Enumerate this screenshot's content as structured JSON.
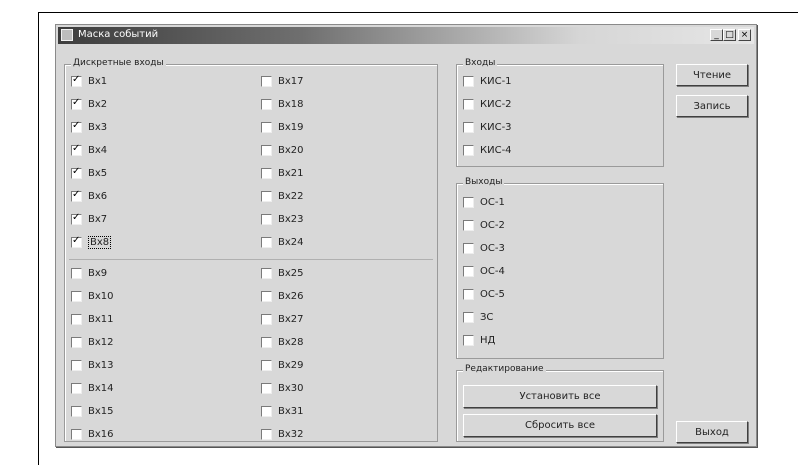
{
  "window": {
    "title": "Маска событий",
    "controls": {
      "minimize": "_",
      "maximize": "□",
      "close": "×"
    }
  },
  "discrete_inputs": {
    "legend": "Дискретные входы",
    "col1": [
      {
        "label": "Вх1",
        "checked": true
      },
      {
        "label": "Вх2",
        "checked": true
      },
      {
        "label": "Вх3",
        "checked": true
      },
      {
        "label": "Вх4",
        "checked": true
      },
      {
        "label": "Вх5",
        "checked": true
      },
      {
        "label": "Вх6",
        "checked": true
      },
      {
        "label": "Вх7",
        "checked": true
      },
      {
        "label": "Вх8",
        "checked": true
      },
      {
        "label": "Вх9",
        "checked": false
      },
      {
        "label": "Вх10",
        "checked": false
      },
      {
        "label": "Вх11",
        "checked": false
      },
      {
        "label": "Вх12",
        "checked": false
      },
      {
        "label": "Вх13",
        "checked": false
      },
      {
        "label": "Вх14",
        "checked": false
      },
      {
        "label": "Вх15",
        "checked": false
      },
      {
        "label": "Вх16",
        "checked": false
      }
    ],
    "col2": [
      {
        "label": "Вх17",
        "checked": false
      },
      {
        "label": "Вх18",
        "checked": false
      },
      {
        "label": "Вх19",
        "checked": false
      },
      {
        "label": "Вх20",
        "checked": false
      },
      {
        "label": "Вх21",
        "checked": false
      },
      {
        "label": "Вх22",
        "checked": false
      },
      {
        "label": "Вх23",
        "checked": false
      },
      {
        "label": "Вх24",
        "checked": false
      },
      {
        "label": "Вх25",
        "checked": false
      },
      {
        "label": "Вх26",
        "checked": false
      },
      {
        "label": "Вх27",
        "checked": false
      },
      {
        "label": "Вх28",
        "checked": false
      },
      {
        "label": "Вх29",
        "checked": false
      },
      {
        "label": "Вх30",
        "checked": false
      },
      {
        "label": "Вх31",
        "checked": false
      },
      {
        "label": "Вх32",
        "checked": false
      }
    ]
  },
  "inputs_group": {
    "legend": "Входы",
    "items": [
      {
        "label": "КИС-1",
        "checked": false
      },
      {
        "label": "КИС-2",
        "checked": false
      },
      {
        "label": "КИС-3",
        "checked": false
      },
      {
        "label": "КИС-4",
        "checked": false
      }
    ]
  },
  "outputs_group": {
    "legend": "Выходы",
    "items": [
      {
        "label": "ОС-1",
        "checked": false
      },
      {
        "label": "ОС-2",
        "checked": false
      },
      {
        "label": "ОС-3",
        "checked": false
      },
      {
        "label": "ОС-4",
        "checked": false
      },
      {
        "label": "ОС-5",
        "checked": false
      },
      {
        "label": "ЗС",
        "checked": false
      },
      {
        "label": "НД",
        "checked": false
      }
    ]
  },
  "editing_group": {
    "legend": "Редактирование",
    "set_all": "Установить все",
    "reset_all": "Сбросить все"
  },
  "buttons": {
    "read": "Чтение",
    "write": "Запись",
    "exit": "Выход"
  }
}
